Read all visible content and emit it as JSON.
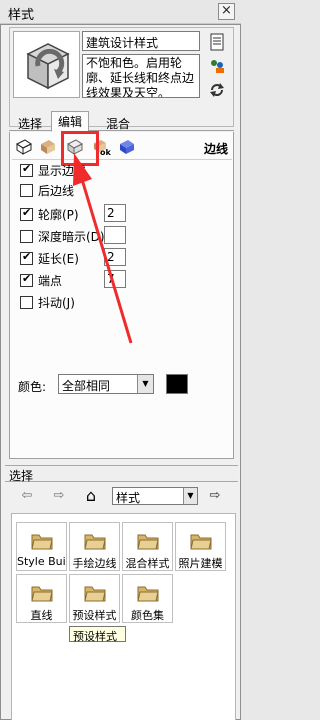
{
  "window": {
    "title": "样式",
    "close": "×"
  },
  "style": {
    "name": "建筑设计样式",
    "description": "不饱和色。启用轮廓、延长线和终点边线效果及天空。"
  },
  "tabs": [
    "选择",
    "编辑",
    "混合"
  ],
  "active_tab": "编辑",
  "edit": {
    "section_label": "边线",
    "show_edges": "显示边线",
    "back_edges": "后边线",
    "profiles": {
      "label": "轮廓(P)",
      "value": "2"
    },
    "depth_cue": {
      "label": "深度暗示(D)",
      "value": ""
    },
    "extension": {
      "label": "延长(E)",
      "value": "2"
    },
    "endpoints": {
      "label": "端点",
      "value": "7"
    },
    "jitter": "抖动(J)",
    "color_label": "颜色:",
    "color_value": "全部相同",
    "color_swatch": "#000000"
  },
  "select_section": {
    "header": "选择",
    "library": "样式",
    "folders": [
      "Style Buil",
      "手绘边线",
      "混合样式",
      "照片建模",
      "直线",
      "预设样式",
      "颜色集"
    ],
    "tooltip": "预设样式"
  },
  "annotation_color": "#ef2b2b"
}
